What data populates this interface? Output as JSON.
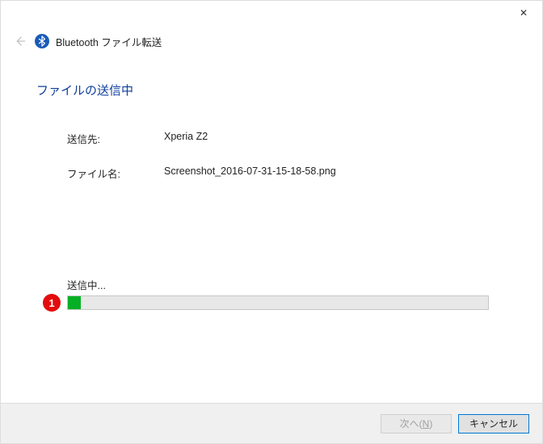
{
  "window": {
    "title": "Bluetooth ファイル転送",
    "close_label": "✕"
  },
  "page": {
    "title": "ファイルの送信中"
  },
  "fields": {
    "destination_label": "送信先:",
    "destination_value": "Xperia Z2",
    "filename_label": "ファイル名:",
    "filename_value": "Screenshot_2016-07-31-15-18-58.png"
  },
  "progress": {
    "label": "送信中...",
    "percent": 3
  },
  "annotation": {
    "badge": "1"
  },
  "footer": {
    "next_prefix": "次へ(",
    "next_key": "N",
    "next_suffix": ")",
    "cancel_label": "キャンセル"
  },
  "colors": {
    "accent_blue": "#0d3f9b",
    "progress_green": "#06b025",
    "annotation_red": "#e30c0c",
    "focus_blue": "#0078d7"
  }
}
